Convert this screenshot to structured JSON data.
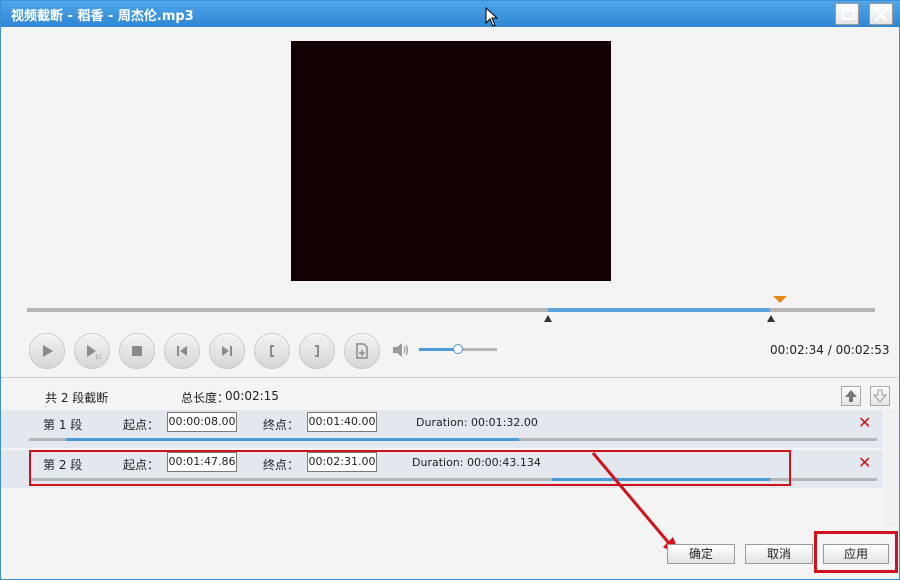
{
  "window": {
    "title": "视频截断 - 稻香 - 周杰伦.mp3",
    "maximize_icon": "maximize-icon",
    "close_icon": "close-icon"
  },
  "player": {
    "current_time": "00:02:34",
    "total_time": "00:02:53",
    "time_display": "00:02:34 / 00:02:53",
    "volume_level": 0.5,
    "controls": [
      {
        "name": "play-icon"
      },
      {
        "name": "play-segment-icon"
      },
      {
        "name": "stop-icon"
      },
      {
        "name": "previous-icon"
      },
      {
        "name": "next-icon"
      },
      {
        "name": "set-start-icon"
      },
      {
        "name": "set-end-icon"
      },
      {
        "name": "add-segment-icon"
      }
    ]
  },
  "summary": {
    "count_text": "共 2 段截断",
    "total_length_label": "总长度：",
    "total_length_value": "00:02:15"
  },
  "segments": [
    {
      "label": "第 1 段",
      "start_label": "起点：",
      "start": "00:00:08.00",
      "end_label": "终点：",
      "end": "00:01:40.00",
      "duration": "Duration: 00:01:32.00"
    },
    {
      "label": "第 2 段",
      "start_label": "起点：",
      "start": "00:01:47.86",
      "end_label": "终点：",
      "end": "00:02:31.00",
      "duration": "Duration: 00:00:43.134"
    }
  ],
  "buttons": {
    "ok": "确定",
    "cancel": "取消",
    "apply": "应用"
  },
  "colors": {
    "accent": "#2f86d2",
    "highlight_red": "#d0121a",
    "delete_red": "#d01010",
    "progress_blue": "#4a9ad8"
  }
}
